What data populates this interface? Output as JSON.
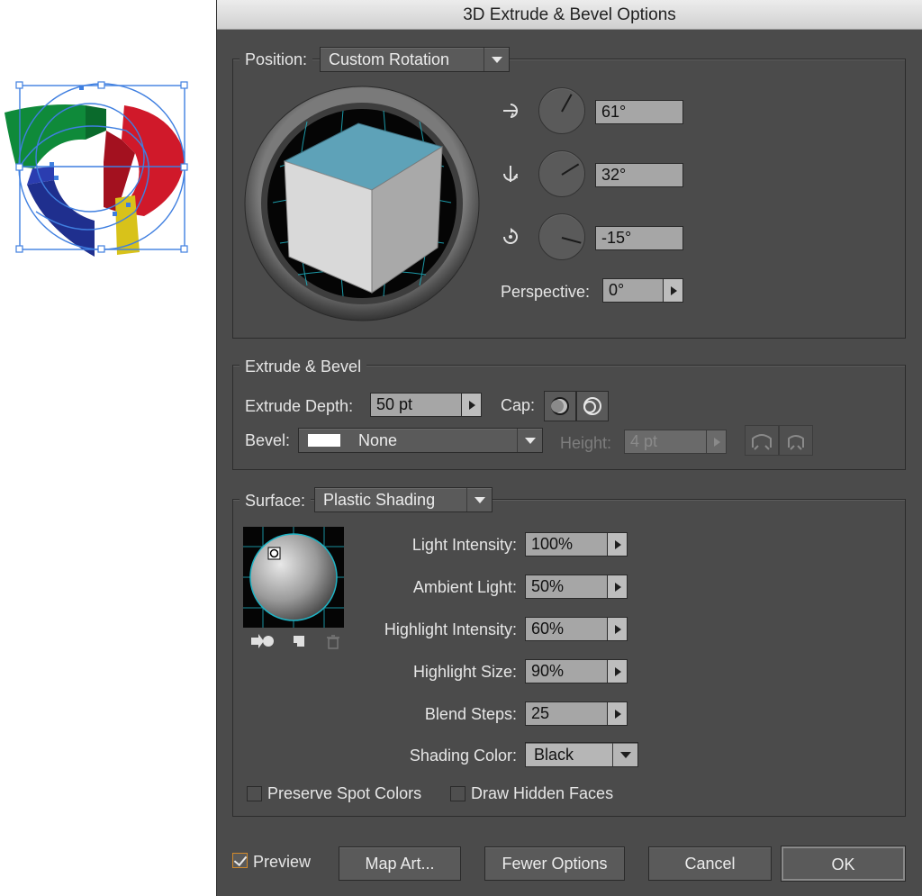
{
  "dialog": {
    "title": "3D Extrude & Bevel Options"
  },
  "position": {
    "label": "Position:",
    "preset": "Custom Rotation",
    "rotations": [
      {
        "axis": "x",
        "icon": "x-axis-rotate-icon",
        "value": "61°",
        "dial_angle_deg": -61
      },
      {
        "axis": "y",
        "icon": "y-axis-rotate-icon",
        "value": "32°",
        "dial_angle_deg": -32
      },
      {
        "axis": "z",
        "icon": "z-axis-rotate-icon",
        "value": "-15°",
        "dial_angle_deg": 15
      }
    ],
    "perspective_label": "Perspective:",
    "perspective_value": "0°"
  },
  "extrude": {
    "title": "Extrude & Bevel",
    "depth_label": "Extrude Depth:",
    "depth_value": "50 pt",
    "cap_label": "Cap:",
    "bevel_label": "Bevel:",
    "bevel_value": "None",
    "height_label": "Height:",
    "height_value": "4 pt"
  },
  "surface": {
    "label": "Surface:",
    "value": "Plastic Shading",
    "fields": [
      {
        "label": "Light Intensity:",
        "value": "100%"
      },
      {
        "label": "Ambient Light:",
        "value": "50%"
      },
      {
        "label": "Highlight Intensity:",
        "value": "60%"
      },
      {
        "label": "Highlight Size:",
        "value": "90%"
      },
      {
        "label": "Blend Steps:",
        "value": "25"
      }
    ],
    "shading_color_label": "Shading Color:",
    "shading_color_value": "Black",
    "preserve_spot_colors": {
      "label": "Preserve Spot Colors",
      "checked": false
    },
    "draw_hidden_faces": {
      "label": "Draw Hidden Faces",
      "checked": false
    }
  },
  "footer": {
    "preview": {
      "label": "Preview",
      "checked": true
    },
    "map_art": "Map Art...",
    "fewer_options": "Fewer Options",
    "cancel": "Cancel",
    "ok": "OK"
  },
  "colors": {
    "dialog_bg": "#4b4b4b",
    "cube_top": "#5ea2b8",
    "grid_cyan": "#1fb3c4",
    "art_green": "#0f8a3a",
    "art_red": "#d0192a",
    "art_blue": "#1f2f8e",
    "art_yellow": "#d8c21a",
    "selection_blue": "#3f7fe0"
  }
}
